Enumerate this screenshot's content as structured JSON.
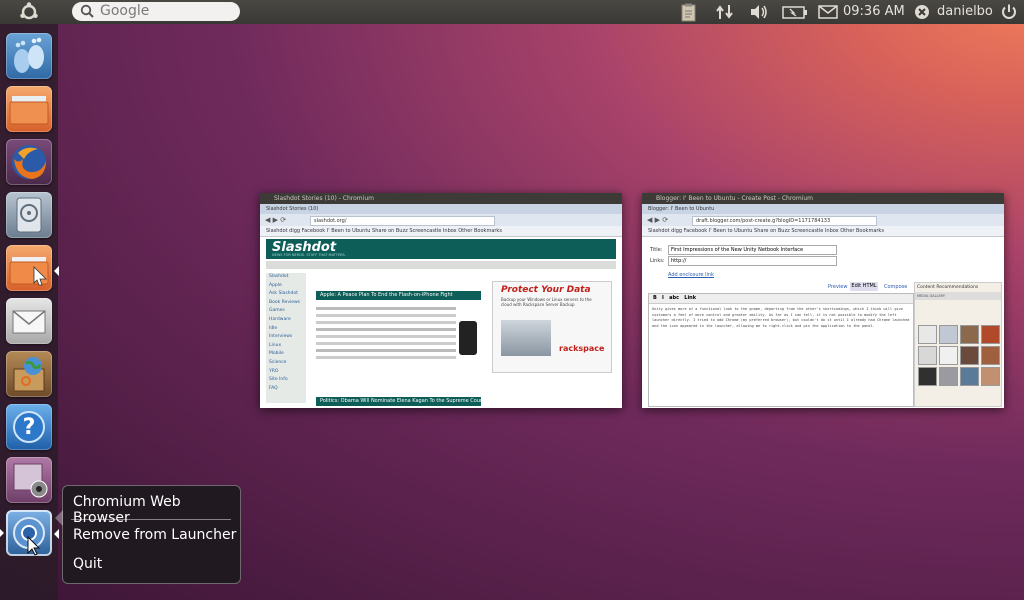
{
  "panel": {
    "search_placeholder": "Google",
    "clock": "09:36 AM",
    "user": "danielbo",
    "icons": [
      "ubuntu-logo-icon",
      "clipboard-icon",
      "network-icon",
      "volume-icon",
      "battery-icon",
      "mail-icon",
      "user-icon",
      "power-icon"
    ]
  },
  "launcher": {
    "items": [
      {
        "name": "Ubuntu Software",
        "icon": "footprint-icon"
      },
      {
        "name": "Home Folder",
        "icon": "folder-icon"
      },
      {
        "name": "Firefox",
        "icon": "firefox-icon"
      },
      {
        "name": "Disk",
        "icon": "disk-icon"
      },
      {
        "name": "Files",
        "icon": "files-icon"
      },
      {
        "name": "Mail",
        "icon": "envelope-icon"
      },
      {
        "name": "Ubuntu One",
        "icon": "package-globe-icon"
      },
      {
        "name": "Help",
        "icon": "help-icon"
      },
      {
        "name": "Cheese",
        "icon": "webcam-icon"
      },
      {
        "name": "Chromium",
        "icon": "chromium-icon"
      }
    ]
  },
  "windows": [
    {
      "title": "Slashdot Stories (10) - Chromium",
      "tab": "Slashdot Stories (10)",
      "url": "slashdot.org/",
      "bookmarks": "Slashdot  digg  Facebook  I' Been to Ubuntu  Share on Buzz  Screencastle  Inbox  Other Bookmarks",
      "logo": "Slashdot",
      "tagline": "NEWS FOR NERDS. STUFF THAT MATTERS.",
      "headline": "Apple: A Peace Plan To End the Flash-on-iPhone Fight",
      "headline2": "Politics: Obama Will Nominate Elena Kagan To the Supreme Court",
      "ad_title": "Protect Your Data",
      "ad_text": "Backup your Windows or Linux servers to the cloud with Rackspace Server Backup",
      "ad_brand": "rackspace",
      "sidebar_links": [
        "Slashdot",
        "Apple",
        "Ask Slashdot",
        "Book Reviews",
        "Games",
        "Hardware",
        "Idle",
        "Interviews",
        "Linux",
        "Mobile",
        "Science",
        "YRO",
        "Site Info",
        "FAQ"
      ]
    },
    {
      "title": "Blogger: I' Been to Ubuntu - Create Post - Chromium",
      "tab": "Blogger: I' Been to Ubuntu",
      "url": "draft.blogger.com/post-create.g?blogID=1171784133",
      "bookmarks": "Slashdot  digg  Facebook  I' Been to Ubuntu  Share on Buzz  Screencastle  Inbox  Other Bookmarks",
      "post_title_label": "Title:",
      "post_title_value": "First Impressions of the New Unity Netbook Interface",
      "link_label": "Links:",
      "link_value": "http://",
      "enclosure_link": "Add enclosure link",
      "tab_preview": "Preview",
      "tab_edit_html": "Edit HTML",
      "tab_compose": "Compose",
      "side_title": "Content Recommendations",
      "side_sub": "MEDIA GALLERY",
      "body_text": "Unity gives more of a functional look to the gnome, departing from the other's shortcomings, which I think will give customers a feel of more control and greater ability. As far as I can tell, it is not possible to modify the left launcher directly. I tried to add Chrome (my preferred browser), but couldn't do it until I already had Chrome launched and the icon appeared in the launcher, allowing me to right-click and pin the application to the panel."
    }
  ],
  "quicklist": {
    "title": "Chromium Web Browser",
    "items": [
      "Remove from Launcher",
      "Quit"
    ]
  }
}
